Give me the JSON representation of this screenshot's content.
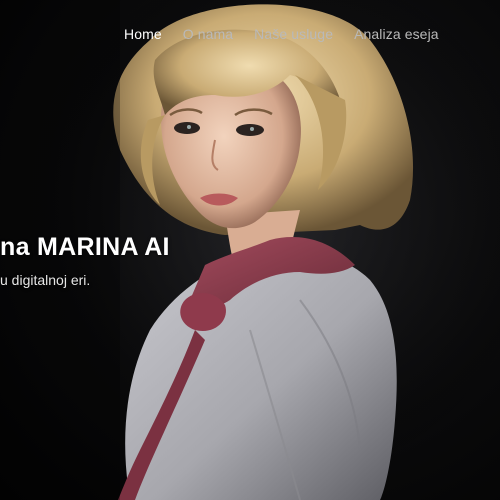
{
  "nav": {
    "items": [
      {
        "label": "Home",
        "active": true
      },
      {
        "label": "O nama",
        "active": false
      },
      {
        "label": "Naše usluge",
        "active": false
      },
      {
        "label": "Analiza eseja",
        "active": false
      }
    ]
  },
  "hero": {
    "headline": "na MARINA AI",
    "subtitle": "u digitalnoj eri."
  },
  "colors": {
    "background": "#000000",
    "nav_active": "#ffffff",
    "nav_inactive": "#b9b9b9",
    "hair": "#d7bf8e",
    "shirt": "#b8b8bd",
    "scarf": "#8c3b4c"
  }
}
